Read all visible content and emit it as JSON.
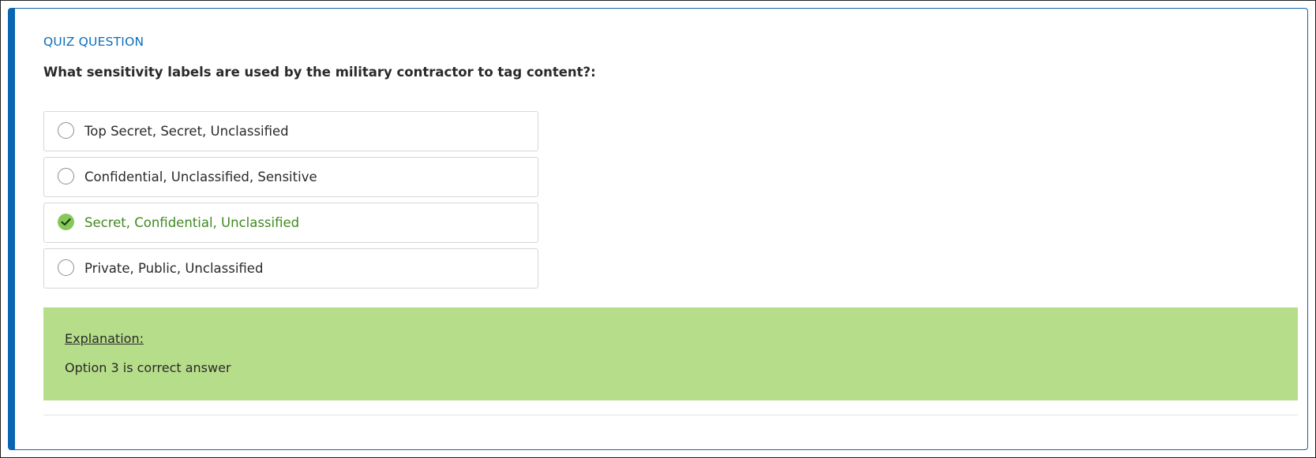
{
  "quiz": {
    "section_title": "QUIZ QUESTION",
    "question": "What sensitivity labels are used by the military contractor to tag content?:",
    "options": [
      {
        "label": "Top Secret, Secret, Unclassified",
        "state": "unselected"
      },
      {
        "label": "Confidential, Unclassified, Sensitive",
        "state": "unselected"
      },
      {
        "label": "Secret, Confidential, Unclassified",
        "state": "correct-selected"
      },
      {
        "label": "Private, Public, Unclassified",
        "state": "unselected"
      }
    ],
    "explanation": {
      "heading": "Explanation:",
      "text": "Option 3 is correct answer"
    }
  },
  "colors": {
    "accent": "#0a66b2",
    "title": "#0a6fbd",
    "correct_text": "#3f8a1f",
    "correct_icon": "#86c85a",
    "explanation_bg": "#b6dd8a"
  },
  "icons": {
    "radio_unselected": "radio-circle-icon",
    "radio_correct": "check-circle-icon"
  }
}
